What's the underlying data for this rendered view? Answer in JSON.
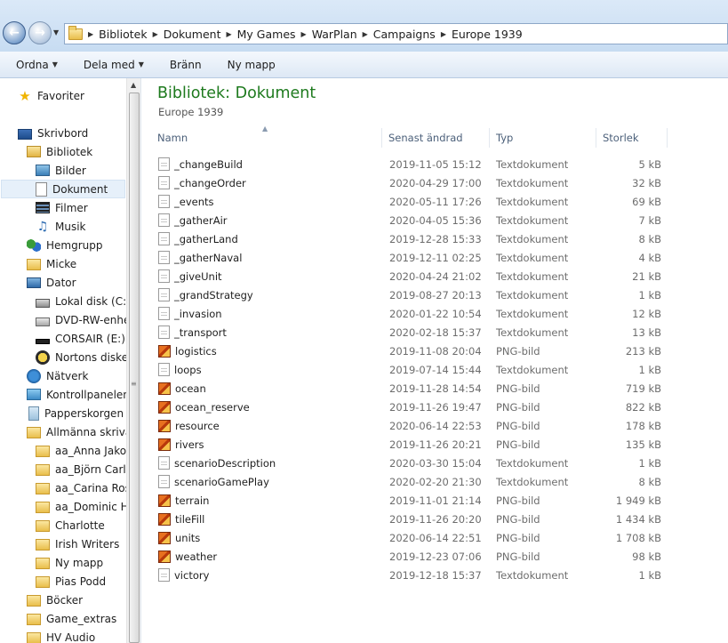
{
  "address": {
    "crumbs": [
      "Bibliotek",
      "Dokument",
      "My Games",
      "WarPlan",
      "Campaigns",
      "Europe 1939"
    ]
  },
  "toolbar": {
    "organize": "Ordna",
    "share": "Dela med",
    "burn": "Bränn",
    "new_folder": "Ny mapp"
  },
  "nav": {
    "favorites": "Favoriter",
    "desktop": "Skrivbord",
    "libraries": "Bibliotek",
    "pictures": "Bilder",
    "documents": "Dokument",
    "videos": "Filmer",
    "music": "Musik",
    "homegroup": "Hemgrupp",
    "micke": "Micke",
    "computer": "Dator",
    "local_disk": "Lokal disk (C:)",
    "dvd": "DVD-RW-enhet",
    "corsair": "CORSAIR (E:)",
    "nortons": "Nortons disken",
    "network": "Nätverk",
    "control_panel": "Kontrollpanelen",
    "recycle": "Papperskorgen",
    "public": "Allmänna skrivak",
    "anna": "aa_Anna Jakob",
    "bjorn": "aa_Björn Carlss",
    "carina": "aa_Carina Rose",
    "dominic": "aa_Dominic Hc",
    "charlotte": "Charlotte",
    "irish": "Irish Writers",
    "ny_mapp": "Ny mapp",
    "pias": "Pias Podd",
    "bocker": "Böcker",
    "game_extras": "Game_extras",
    "hv_audio": "HV Audio"
  },
  "content": {
    "title": "Bibliotek: Dokument",
    "subtitle": "Europe 1939",
    "columns": {
      "name": "Namn",
      "date": "Senast ändrad",
      "type": "Typ",
      "size": "Storlek"
    },
    "files": [
      {
        "name": "_changeBuild",
        "date": "2019-11-05 15:12",
        "type": "Textdokument",
        "size": "5 kB",
        "icon": "text-file-icon"
      },
      {
        "name": "_changeOrder",
        "date": "2020-04-29 17:00",
        "type": "Textdokument",
        "size": "32 kB",
        "icon": "text-file-icon"
      },
      {
        "name": "_events",
        "date": "2020-05-11 17:26",
        "type": "Textdokument",
        "size": "69 kB",
        "icon": "text-file-icon"
      },
      {
        "name": "_gatherAir",
        "date": "2020-04-05 15:36",
        "type": "Textdokument",
        "size": "7 kB",
        "icon": "text-file-icon"
      },
      {
        "name": "_gatherLand",
        "date": "2019-12-28 15:33",
        "type": "Textdokument",
        "size": "8 kB",
        "icon": "text-file-icon"
      },
      {
        "name": "_gatherNaval",
        "date": "2019-12-11 02:25",
        "type": "Textdokument",
        "size": "4 kB",
        "icon": "text-file-icon"
      },
      {
        "name": "_giveUnit",
        "date": "2020-04-24 21:02",
        "type": "Textdokument",
        "size": "21 kB",
        "icon": "text-file-icon"
      },
      {
        "name": "_grandStrategy",
        "date": "2019-08-27 20:13",
        "type": "Textdokument",
        "size": "1 kB",
        "icon": "text-file-icon"
      },
      {
        "name": "_invasion",
        "date": "2020-01-22 10:54",
        "type": "Textdokument",
        "size": "12 kB",
        "icon": "text-file-icon"
      },
      {
        "name": "_transport",
        "date": "2020-02-18 15:37",
        "type": "Textdokument",
        "size": "13 kB",
        "icon": "text-file-icon"
      },
      {
        "name": "logistics",
        "date": "2019-11-08 20:04",
        "type": "PNG-bild",
        "size": "213 kB",
        "icon": "png-file-icon"
      },
      {
        "name": "loops",
        "date": "2019-07-14 15:44",
        "type": "Textdokument",
        "size": "1 kB",
        "icon": "text-file-icon"
      },
      {
        "name": "ocean",
        "date": "2019-11-28 14:54",
        "type": "PNG-bild",
        "size": "719 kB",
        "icon": "png-file-icon"
      },
      {
        "name": "ocean_reserve",
        "date": "2019-11-26 19:47",
        "type": "PNG-bild",
        "size": "822 kB",
        "icon": "png-file-icon"
      },
      {
        "name": "resource",
        "date": "2020-06-14 22:53",
        "type": "PNG-bild",
        "size": "178 kB",
        "icon": "png-file-icon"
      },
      {
        "name": "rivers",
        "date": "2019-11-26 20:21",
        "type": "PNG-bild",
        "size": "135 kB",
        "icon": "png-file-icon"
      },
      {
        "name": "scenarioDescription",
        "date": "2020-03-30 15:04",
        "type": "Textdokument",
        "size": "1 kB",
        "icon": "text-file-icon"
      },
      {
        "name": "scenarioGamePlay",
        "date": "2020-02-20 21:30",
        "type": "Textdokument",
        "size": "8 kB",
        "icon": "text-file-icon"
      },
      {
        "name": "terrain",
        "date": "2019-11-01 21:14",
        "type": "PNG-bild",
        "size": "1 949 kB",
        "icon": "png-file-icon"
      },
      {
        "name": "tileFill",
        "date": "2019-11-26 20:20",
        "type": "PNG-bild",
        "size": "1 434 kB",
        "icon": "png-file-icon"
      },
      {
        "name": "units",
        "date": "2020-06-14 22:51",
        "type": "PNG-bild",
        "size": "1 708 kB",
        "icon": "png-file-icon"
      },
      {
        "name": "weather",
        "date": "2019-12-23 07:06",
        "type": "PNG-bild",
        "size": "98 kB",
        "icon": "png-file-icon"
      },
      {
        "name": "victory",
        "date": "2019-12-18 15:37",
        "type": "Textdokument",
        "size": "1 kB",
        "icon": "text-file-icon"
      }
    ]
  },
  "colors": {
    "library_title": "#1e7a1e",
    "selected_bg": "#e6f0fa"
  }
}
